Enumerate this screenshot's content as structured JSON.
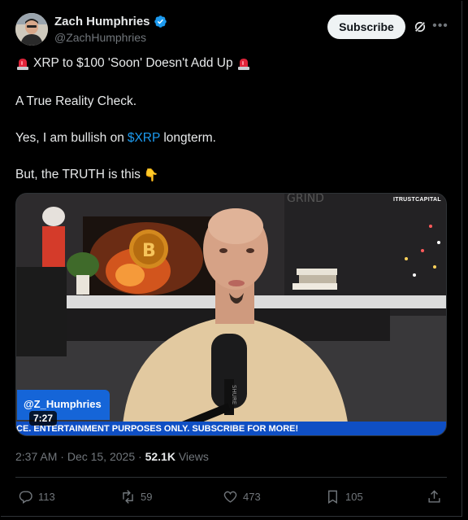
{
  "author": {
    "name": "Zach Humphries",
    "handle": "@ZachHumphries",
    "verified": true,
    "verified_color": "#1d9bf0"
  },
  "header": {
    "subscribe_label": "Subscribe",
    "grok_icon": "grok-icon",
    "more_icon": "more-icon"
  },
  "post": {
    "line1": "XRP to $100 'Soon' Doesn't Add Up",
    "line1_emoji": "siren-emoji",
    "line2": "A True Reality Check.",
    "line3_before": "Yes, I am bullish on",
    "line3_cashtag": "$XRP",
    "line3_after": "longterm.",
    "line4": "But, the TRUTH is this",
    "line4_emoji": "👇"
  },
  "media": {
    "overlay_handle": "@Z_Humphries",
    "duration": "7:27",
    "ticker": "CE. ENTERTAINMENT PURPOSES ONLY. SUBSCRIBE FOR MORE!",
    "watermark": "ITRUSTCAPITAL",
    "wall_text": "GRIND",
    "mic_text": "SHURE"
  },
  "meta": {
    "time": "2:37 AM",
    "separator": "·",
    "date": "Dec 15, 2025",
    "separator2": "·",
    "views_count": "52.1K",
    "views_label": "Views"
  },
  "actions": {
    "replies": "113",
    "reposts": "59",
    "likes": "473",
    "bookmarks": "105"
  },
  "colors": {
    "background": "#000000",
    "text": "#e7e9ea",
    "muted": "#71767b",
    "link": "#1d9bf0",
    "ticker_blue": "#0f4fc4"
  }
}
